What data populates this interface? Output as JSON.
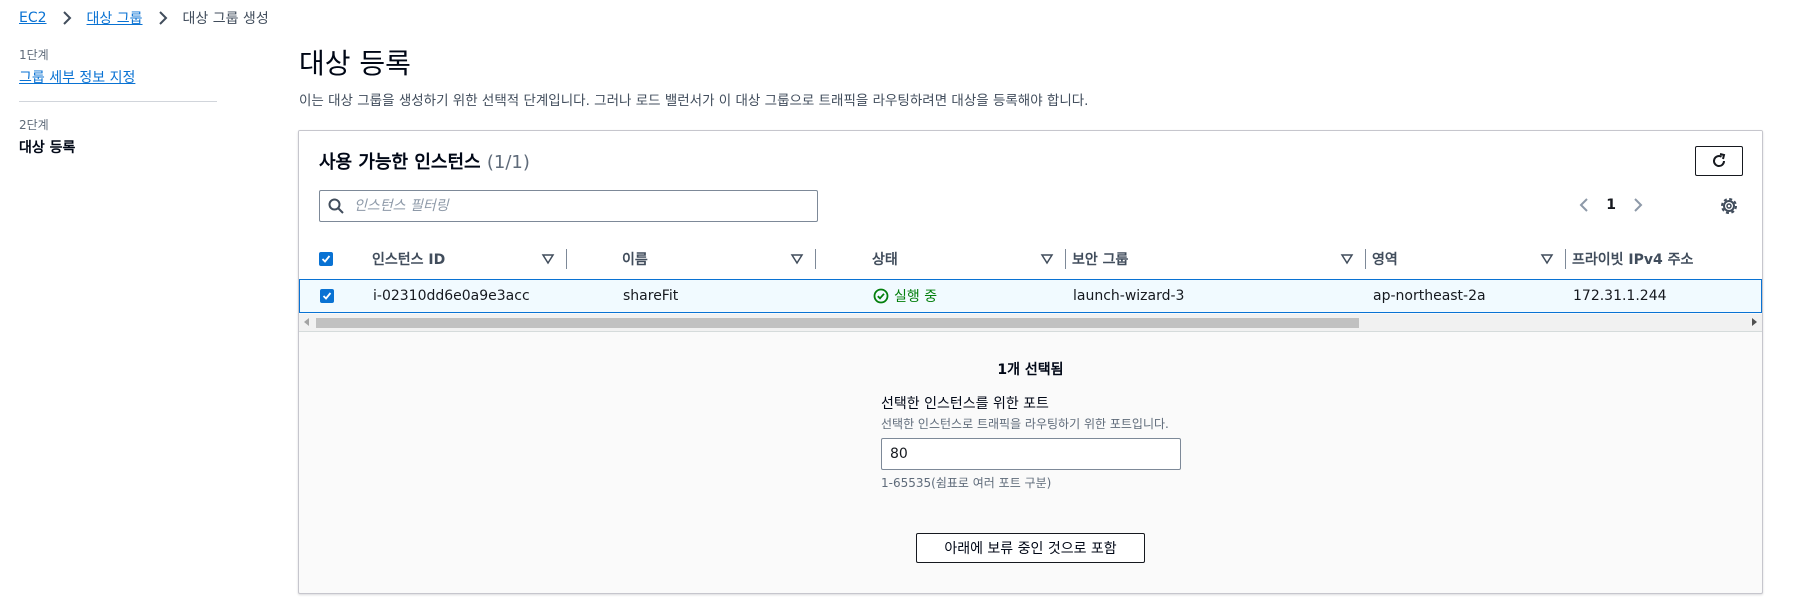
{
  "breadcrumb": {
    "items": [
      "EC2",
      "대상 그룹"
    ],
    "current": "대상 그룹 생성"
  },
  "steps": [
    {
      "number": "1단계",
      "title": "그룹 세부 정보 지정"
    },
    {
      "number": "2단계",
      "title": "대상 등록"
    }
  ],
  "header": {
    "title": "대상 등록",
    "description": "이는 대상 그룹을 생성하기 위한 선택적 단계입니다. 그러나 로드 밸런서가 이 대상 그룹으로 트래픽을 라우팅하려면 대상을 등록해야 합니다."
  },
  "instances": {
    "title": "사용 가능한 인스턴스",
    "count": "(1/1)",
    "filter_placeholder": "인스턴스 필터링",
    "page": "1",
    "columns": [
      "인스턴스 ID",
      "이름",
      "상태",
      "보안 그룹",
      "영역",
      "프라이빗 IPv4 주소"
    ],
    "rows": [
      {
        "id": "i-02310dd6e0a9e3acc",
        "name": "shareFit",
        "status": "실행 중",
        "security_group": "launch-wizard-3",
        "zone": "ap-northeast-2a",
        "private_ip": "172.31.1.244"
      }
    ]
  },
  "selection": {
    "count_label": "1개 선택됨",
    "port_label": "선택한 인스턴스를 위한 포트",
    "port_description": "선택한 인스턴스로 트래픽을 라우팅하기 위한 포트입니다.",
    "port_value": "80",
    "port_hint": "1-65535(쉼표로 여러 포트 구분)",
    "include_button": "아래에 보류 중인 것으로 포함"
  },
  "colors": {
    "link": "#0972d3",
    "running": "#037f0c",
    "selected_row_bg": "#f1faff"
  }
}
